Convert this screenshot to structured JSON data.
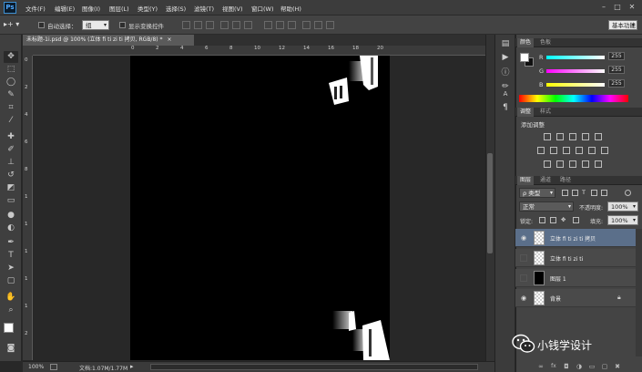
{
  "app": {
    "logo": "Ps"
  },
  "menu": [
    "文件(F)",
    "编辑(E)",
    "图像(I)",
    "图层(L)",
    "类型(Y)",
    "选择(S)",
    "滤镜(T)",
    "视图(V)",
    "窗口(W)",
    "帮助(H)"
  ],
  "window_controls": {
    "minimize": "–",
    "restore": "□",
    "close": "✕"
  },
  "options_bar": {
    "auto_select_label": "自动选择：",
    "auto_select_value": "组",
    "show_transform_label": "显示变换控件",
    "workspace": "基本功能"
  },
  "document": {
    "tab_title": "未标题-1i.psd @ 100% (立体 fi  ti  zi  ti 拷贝, RGB/8) *",
    "tab_close": "×",
    "zoom": "100%",
    "doc_info": "文档:1.07M/1.77M"
  },
  "ruler": {
    "h": [
      "0",
      "2",
      "4",
      "6",
      "8",
      "10",
      "12",
      "14",
      "16",
      "18",
      "20"
    ],
    "v": [
      "0",
      "2",
      "4",
      "6",
      "8",
      "1",
      "1",
      "1",
      "1",
      "1",
      "2"
    ]
  },
  "tools": [
    "move",
    "marquee",
    "lasso",
    "quick-select",
    "crop",
    "eyedropper",
    "healing",
    "brush",
    "stamp",
    "history-brush",
    "eraser",
    "gradient",
    "blur",
    "dodge",
    "pen",
    "type",
    "path-select",
    "shape",
    "hand",
    "zoom"
  ],
  "color_panel": {
    "tabs": [
      "颜色",
      "色板"
    ],
    "channels": [
      {
        "label": "R",
        "value": "255",
        "color": "#ff3b3b"
      },
      {
        "label": "G",
        "value": "255",
        "color": "#39e639"
      },
      {
        "label": "B",
        "value": "255",
        "color": "#3b6bff"
      }
    ]
  },
  "adjust_panel": {
    "tabs": [
      "调整",
      "样式"
    ],
    "title": "添加调整"
  },
  "layers_panel": {
    "tabs": [
      "图层",
      "通道",
      "路径"
    ],
    "filter_kind": "ρ 类型",
    "blend_mode": "正常",
    "opacity_label": "不透明度:",
    "opacity_value": "100%",
    "lock_label": "锁定:",
    "fill_label": "填充:",
    "fill_value": "100%",
    "layers": [
      {
        "name": "立体 fi  ti  zi  ti 拷贝",
        "visible": true,
        "selected": true,
        "thumb": "transparent"
      },
      {
        "name": "立体 fi  ti  zi  ti",
        "visible": false,
        "selected": false,
        "thumb": "transparent"
      },
      {
        "name": "图层 1",
        "visible": false,
        "selected": false,
        "thumb": "black"
      },
      {
        "name": "背景",
        "visible": true,
        "selected": false,
        "thumb": "transparent",
        "locked": true
      }
    ]
  },
  "watermark": {
    "text": "小钱学设计"
  }
}
